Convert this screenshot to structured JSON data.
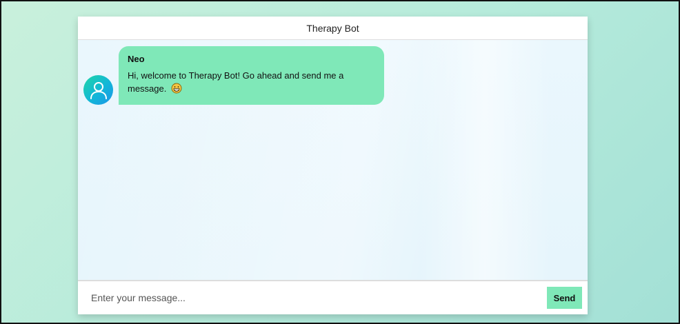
{
  "header": {
    "title": "Therapy Bot"
  },
  "messages": [
    {
      "sender": "Neo",
      "text": "Hi, welcome to Therapy Bot! Go ahead and send me a message.",
      "avatar_icon": "user-icon",
      "emoji_icon": "grinning-face-icon"
    }
  ],
  "composer": {
    "placeholder": "Enter your message...",
    "value": "",
    "send_label": "Send"
  },
  "colors": {
    "accent": "#7fe8b8",
    "avatar_gradient_start": "#1fd6a6",
    "avatar_gradient_end": "#1c95e8",
    "chat_background": "#e6f5fc"
  }
}
